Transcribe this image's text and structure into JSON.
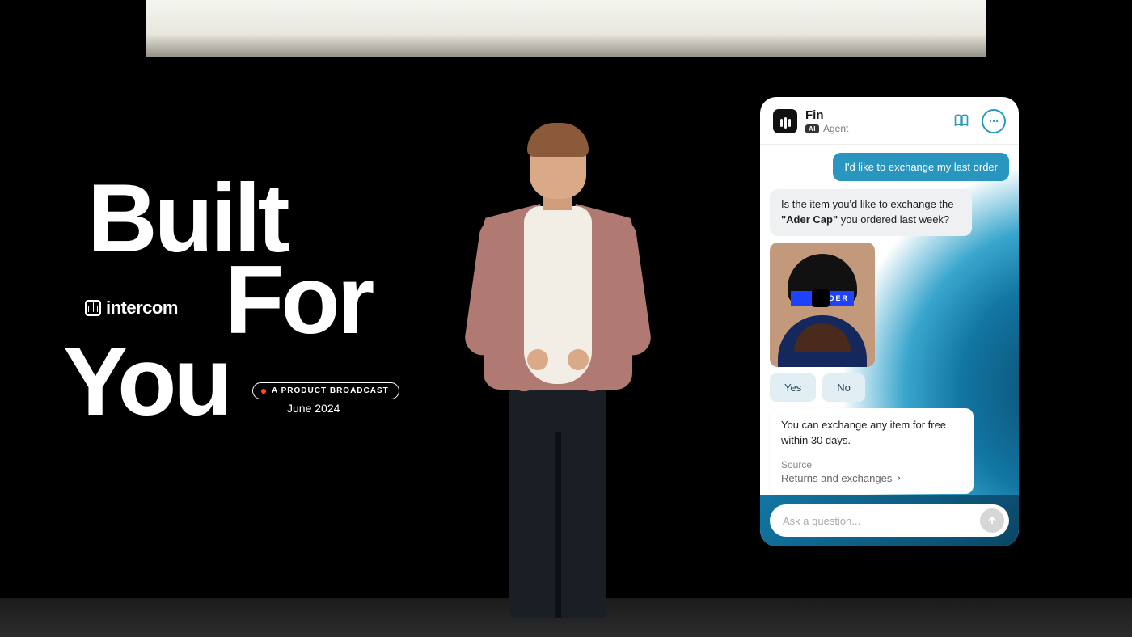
{
  "title": {
    "line1": "Built",
    "line2": "For",
    "line3": "You"
  },
  "brand": "intercom",
  "badge": "A PRODUCT BROADCAST",
  "date": "June 2024",
  "chat": {
    "header": {
      "name": "Fin",
      "ai_tag": "AI",
      "role": "Agent"
    },
    "user_msg": "I'd like to exchange my last order",
    "bot_msg_prefix": "Is the item you'd like to exchange the ",
    "bot_msg_bold": "\"Ader Cap\"",
    "bot_msg_suffix": " you ordered last week?",
    "product_label": "ADER",
    "options": {
      "yes": "Yes",
      "no": "No"
    },
    "info": {
      "body": "You can exchange any item for free within 30 days.",
      "source_label": "Source",
      "source_link": "Returns and exchanges"
    },
    "input_placeholder": "Ask a question..."
  }
}
